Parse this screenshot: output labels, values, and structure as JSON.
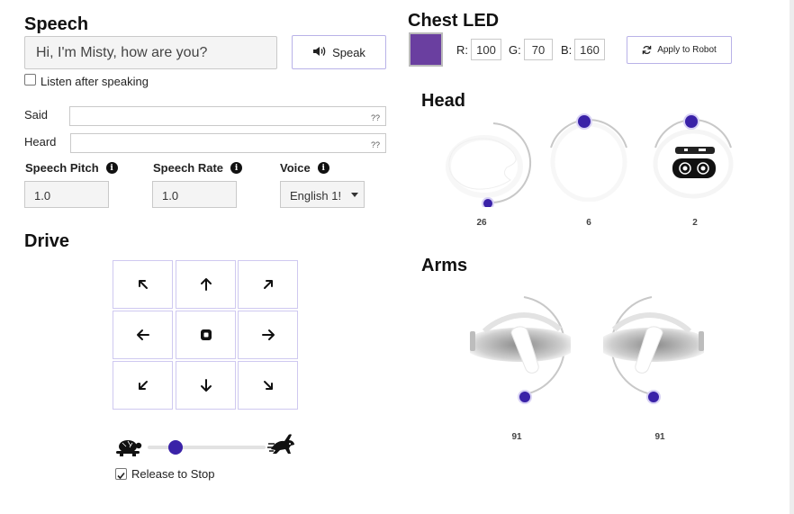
{
  "speech": {
    "title": "Speech",
    "input_value": "Hi, I'm Misty, how are you?",
    "speak_label": "Speak",
    "listen_label": "Listen after speaking",
    "said_label": "Said",
    "said_value": "??",
    "heard_label": "Heard",
    "heard_value": "??",
    "pitch_label": "Speech Pitch",
    "pitch_value": "1.0",
    "rate_label": "Speech Rate",
    "rate_value": "1.0",
    "voice_label": "Voice",
    "voice_value": "English 1!"
  },
  "drive": {
    "title": "Drive",
    "release_label": "Release to Stop",
    "speed_fraction": 0.2
  },
  "chest_led": {
    "title": "Chest LED",
    "r_label": "R:",
    "r_value": "100",
    "g_label": "G:",
    "g_value": "70",
    "b_label": "B:",
    "b_value": "160",
    "apply_label": "Apply to Robot",
    "color": "#6a3fa0"
  },
  "head": {
    "title": "Head",
    "values": [
      "26",
      "6",
      "2"
    ]
  },
  "arms": {
    "title": "Arms",
    "values": [
      "91",
      "91"
    ]
  },
  "colors": {
    "accent": "#3a22a8",
    "border_accent": "#b9b2e8"
  }
}
